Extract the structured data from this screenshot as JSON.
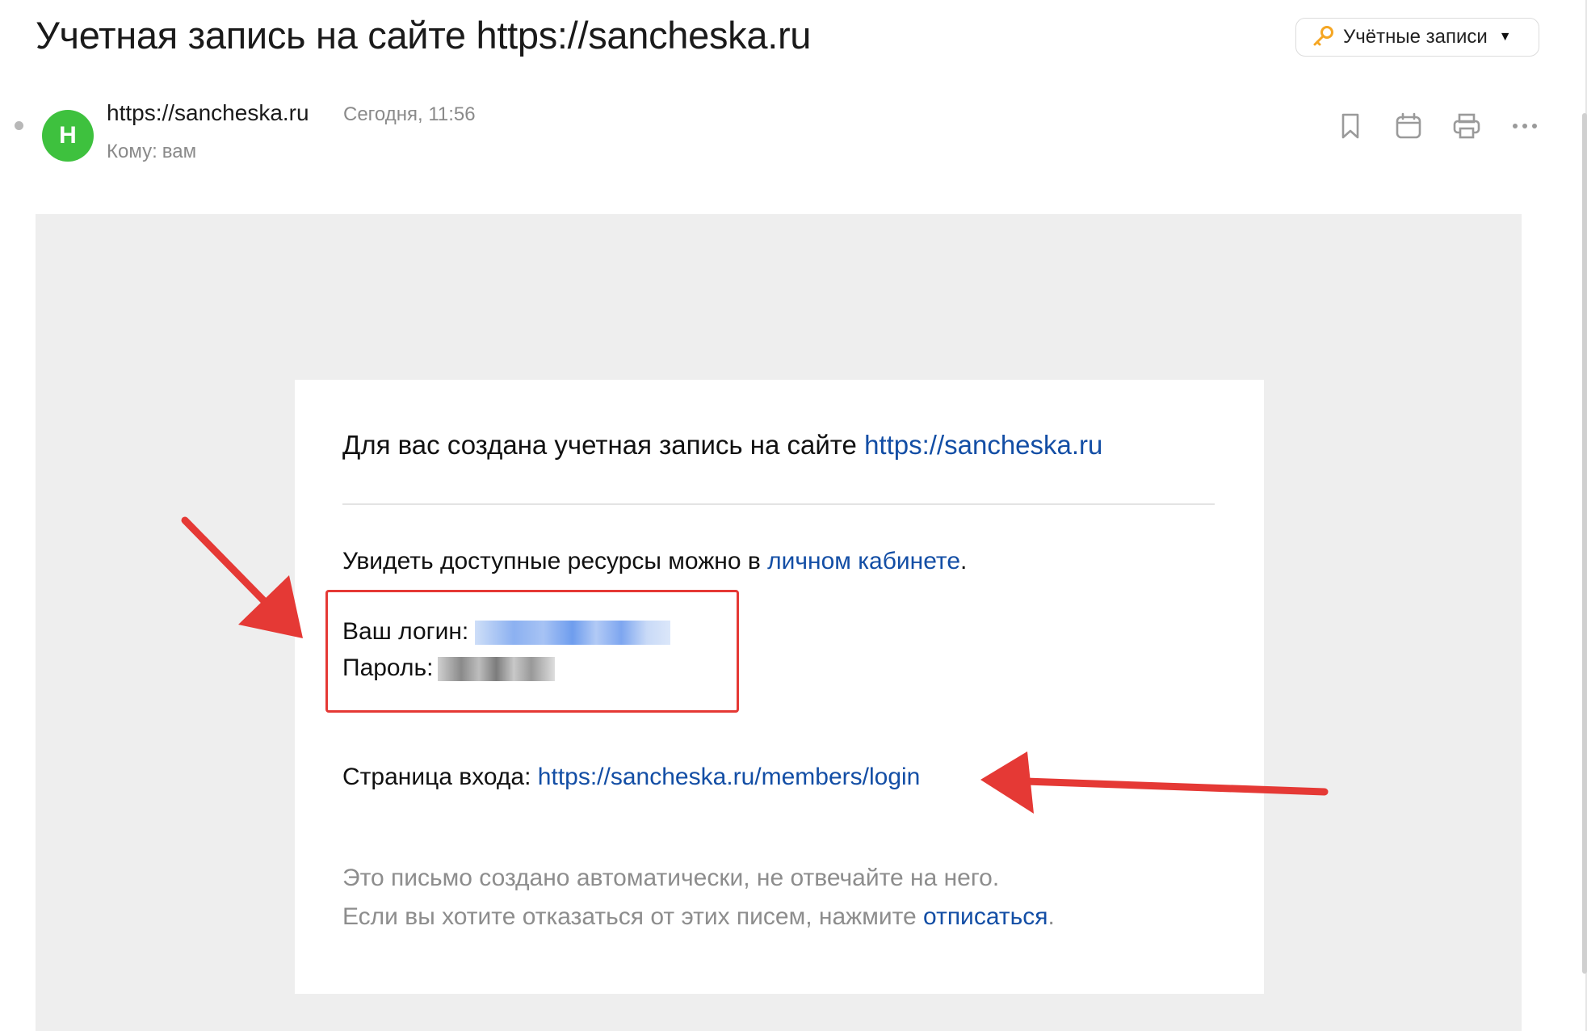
{
  "header": {
    "subject": "Учетная запись на сайте https://sancheska.ru",
    "accounts_button_label": "Учётные записи"
  },
  "message": {
    "avatar_letter": "H",
    "sender": "https://sancheska.ru",
    "date": "Сегодня, 11:56",
    "to_label": "Кому:",
    "to_value": "вам"
  },
  "body": {
    "intro_text": "Для вас создана учетная запись на сайте ",
    "intro_link": "https://sancheska.ru",
    "resources_text": "Увидеть доступные ресурсы можно в ",
    "resources_link": "личном кабинете",
    "resources_end": ".",
    "login_label": "Ваш логин:",
    "password_label": "Пароль:",
    "login_page_label": "Страница входа: ",
    "login_page_link": "https://sancheska.ru/members/login",
    "footer_line1": "Это письмо создано автоматически, не отвечайте на него.",
    "footer_line2_text": "Если вы хотите отказаться от этих писем, нажмите ",
    "footer_unsubscribe": "отписаться",
    "footer_end": "."
  },
  "icons": {
    "accounts": "key-icon",
    "bookmark": "bookmark-icon",
    "calendar": "calendar-icon",
    "print": "printer-icon",
    "more": "more-icon"
  },
  "colors": {
    "avatar": "#3ec13e",
    "link": "#134ea5",
    "annotation_red": "#e53935",
    "mail_background": "#eeeeee"
  }
}
